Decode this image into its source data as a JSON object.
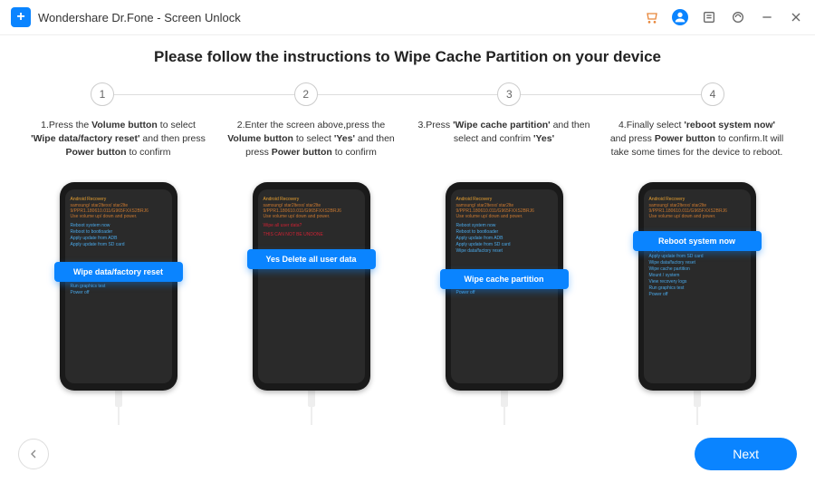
{
  "titlebar": {
    "title": "Wondershare Dr.Fone - Screen Unlock"
  },
  "heading": "Please follow the instructions to Wipe Cache Partition on your device",
  "steps": [
    {
      "num": "1",
      "instr": "1.Press the <b>Volume button</b> to select <b>'Wipe data/factory reset'</b> and then press <b>Power button</b> to confirm",
      "highlight": "Wipe data/factory reset"
    },
    {
      "num": "2",
      "instr": "2.Enter the screen above,press the <b>Volume button</b> to select <b>'Yes'</b> and then press <b>Power button</b> to confirm",
      "highlight": "Yes  Delete all user data"
    },
    {
      "num": "3",
      "instr": "3.Press <b>'Wipe cache partition'</b> and then select and confrim <b>'Yes'</b>",
      "highlight": "Wipe cache partition"
    },
    {
      "num": "4",
      "instr": "4.Finally select <b>'reboot system now'</b> and press <b>Power button</b> to confirm.It will take some times for the device to reboot.",
      "highlight": "Reboot system now"
    }
  ],
  "recovery_header": {
    "title": "Android Recovery",
    "line1": "samsung/ star2ltexx/ star2lte",
    "line2": "9/PPR1.180610.011/G965FXXS2BRJ6",
    "line3": "Use volume up/ down and power."
  },
  "menu_items": [
    "Reboot system now",
    "Reboot to bootloader",
    "Apply update from ADB",
    "Apply update from SD card",
    "Wipe data/factory reset",
    "Wipe cache partition",
    "Mount / system",
    "View recovery logs",
    "Run graphics test",
    "Power off"
  ],
  "warn_text": "THIS CAN NOT BE UNDONE",
  "footer": {
    "next": "Next"
  }
}
